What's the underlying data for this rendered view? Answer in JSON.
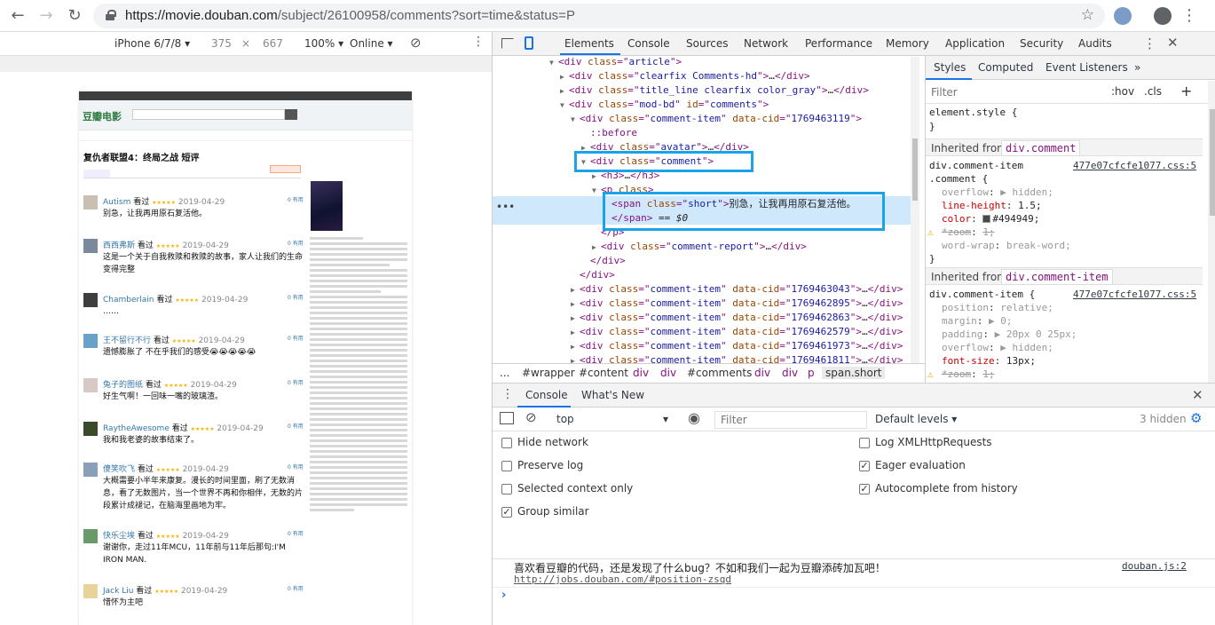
{
  "browser": {
    "url_host": "https://movie.douban.com",
    "url_path": "/subject/26100958/comments?sort=time&status=P"
  },
  "device_toolbar": {
    "device": "iPhone 6/7/8",
    "width": "375",
    "times": "×",
    "height": "667",
    "zoom": "100%",
    "network": "Online"
  },
  "devtools": {
    "tabs": [
      "Elements",
      "Console",
      "Sources",
      "Network",
      "Performance",
      "Memory",
      "Application",
      "Security",
      "Audits"
    ],
    "active_tab": "Elements"
  },
  "elements_tree": {
    "lines": [
      {
        "indent": 0,
        "arrow": "▼",
        "html": "<div class=\"article\">"
      },
      {
        "indent": 1,
        "arrow": "▶",
        "html": "<div class=\"clearfix Comments-hd\">…</div>"
      },
      {
        "indent": 1,
        "arrow": "▶",
        "html": "<div class=\"title_line clearfix color_gray\">…</div>"
      },
      {
        "indent": 1,
        "arrow": "▼",
        "html": "<div class=\"mod-bd\" id=\"comments\">"
      },
      {
        "indent": 2,
        "arrow": "▼",
        "html": "<div class=\"comment-item\" data-cid=\"1769463119\">"
      },
      {
        "indent": 3,
        "arrow": "",
        "html": "::before"
      },
      {
        "indent": 3,
        "arrow": "▶",
        "html": "<div class=\"avatar\">…</div>"
      },
      {
        "indent": 3,
        "arrow": "▼",
        "html": "<div class=\"comment\">"
      },
      {
        "indent": 4,
        "arrow": "▶",
        "html": "<h3>…</h3>"
      },
      {
        "indent": 4,
        "arrow": "▼",
        "html": "<p class>"
      },
      {
        "indent": 5,
        "arrow": "",
        "html": "<span class=\"short\">别急，让我再用原石复活他。"
      },
      {
        "indent": 5,
        "arrow": "",
        "html": "</span> == $0"
      },
      {
        "indent": 4,
        "arrow": "",
        "html": "</p>"
      },
      {
        "indent": 4,
        "arrow": "▶",
        "html": "<div class=\"comment-report\">…</div>"
      },
      {
        "indent": 3,
        "arrow": "",
        "html": "</div>"
      },
      {
        "indent": 2,
        "arrow": "",
        "html": "</div>"
      },
      {
        "indent": 2,
        "arrow": "▶",
        "html": "<div class=\"comment-item\" data-cid=\"1769463043\">…</div>"
      },
      {
        "indent": 2,
        "arrow": "▶",
        "html": "<div class=\"comment-item\" data-cid=\"1769462895\">…</div>"
      },
      {
        "indent": 2,
        "arrow": "▶",
        "html": "<div class=\"comment-item\" data-cid=\"1769462863\">…</div>"
      },
      {
        "indent": 2,
        "arrow": "▶",
        "html": "<div class=\"comment-item\" data-cid=\"1769462579\">…</div>"
      },
      {
        "indent": 2,
        "arrow": "▶",
        "html": "<div class=\"comment-item\" data-cid=\"1769461973\">…</div>"
      },
      {
        "indent": 2,
        "arrow": "▶",
        "html": "<div class=\"comment-item\" data-cid=\"1769461811\">…</div>"
      }
    ]
  },
  "breadcrumbs": [
    "...",
    "#wrapper",
    "#content",
    "div",
    "div",
    "#comments",
    "div",
    "div",
    "p",
    "span.short"
  ],
  "styles_pane": {
    "tabs": [
      "Styles",
      "Computed",
      "Event Listeners",
      "»"
    ],
    "filter_placeholder": "Filter",
    "hov": ":hov",
    "cls": ".cls",
    "plus": "+",
    "element_style": "element.style {",
    "close_brace": "}",
    "inherited_from": "Inherited from",
    "inherited_node_1": "div.comment",
    "inherited_node_2": "div.comment-item",
    "rule1": {
      "selector_1": "div.comment-item",
      "selector_2": ".comment {",
      "source": "477e07cfcfe1077.css:5",
      "props": [
        {
          "name": "overflow",
          "value": "▶ hidden;",
          "state": "disabled"
        },
        {
          "name": "line-height",
          "value": "1.5;",
          "state": "active"
        },
        {
          "name": "color",
          "value": "#494949;",
          "state": "active"
        },
        {
          "name": "*zoom",
          "value": "1;",
          "state": "struck"
        },
        {
          "name": "word-wrap",
          "value": "break-word;",
          "state": "disabled"
        }
      ]
    },
    "rule2": {
      "selector": "div.comment-item {",
      "source": "477e07cfcfe1077.css:5",
      "props": [
        {
          "name": "position",
          "value": "relative;",
          "state": "disabled"
        },
        {
          "name": "margin",
          "value": "▶ 0;",
          "state": "disabled"
        },
        {
          "name": "padding",
          "value": "▶ 20px 0 25px;",
          "state": "disabled"
        },
        {
          "name": "overflow",
          "value": "▶ hidden;",
          "state": "disabled"
        },
        {
          "name": "font-size",
          "value": "13px;",
          "state": "active"
        },
        {
          "name": "*zoom",
          "value": "1;",
          "state": "struck"
        }
      ]
    }
  },
  "console": {
    "tabs": [
      "Console",
      "What's New"
    ],
    "context": "top",
    "filter_placeholder": "Filter",
    "levels": "Default levels",
    "hidden": "3 hidden",
    "options_left": [
      {
        "label": "Hide network",
        "checked": false
      },
      {
        "label": "Preserve log",
        "checked": false
      },
      {
        "label": "Selected context only",
        "checked": false
      },
      {
        "label": "Group similar",
        "checked": true
      }
    ],
    "options_right": [
      {
        "label": "Log XMLHttpRequests",
        "checked": false
      },
      {
        "label": "Eager evaluation",
        "checked": true
      },
      {
        "label": "Autocomplete from history",
        "checked": true
      }
    ],
    "message": "喜欢看豆瓣的代码，还是发现了什么bug？不如和我们一起为豆瓣添砖加瓦吧！",
    "message_link": "http://jobs.douban.com/#position-zsqd",
    "message_source": "douban.js:2",
    "prompt": "›"
  },
  "phone_page": {
    "logo": "豆瓣电影",
    "title": "复仇者联盟4：终局之战 短评",
    "comments": [
      {
        "user": "Autism",
        "kan": "看过",
        "stars": "★★★★★",
        "date": "2019-04-29",
        "text": "别急，让我再用原石复活他。"
      },
      {
        "user": "西西弗斯",
        "kan": "看过",
        "stars": "★★★★★",
        "date": "2019-04-29",
        "text": "这是一个关于自我救赎和救赎的故事，家人让我们的生命变得完整"
      },
      {
        "user": "Chamberlain",
        "kan": "看过",
        "stars": "★★★★★",
        "date": "2019-04-29",
        "text": "……"
      },
      {
        "user": "王不留行不行",
        "kan": "看过",
        "stars": "★★★★★",
        "date": "2019-04-29",
        "text": "遗憾膨胀了 不在乎我们的感受😭😭😭😭😭"
      },
      {
        "user": "兔子的图纸",
        "kan": "看过",
        "stars": "★★★★★",
        "date": "2019-04-29",
        "text": "好生气啊！一回味一嘴的玻璃渣。"
      },
      {
        "user": "RaytheAwesome",
        "kan": "看过",
        "stars": "★★★★★",
        "date": "2019-04-29",
        "text": "我和我老婆的故事结束了。"
      },
      {
        "user": "傻笑吹飞",
        "kan": "看过",
        "stars": "★★★★★",
        "date": "2019-04-29",
        "text": "大概需要小半年来康复。漫长的时间里面，刷了无数消息，看了无数图片，当一个世界不再和你相伴，无数的片段累计成褪记，在脑海里画地为牢。"
      },
      {
        "user": "快乐尘埃",
        "kan": "看过",
        "stars": "★★★★★",
        "date": "2019-04-29",
        "text": "谢谢你，走过11年MCU，11年前与11年后那句:I'M IRON MAN."
      },
      {
        "user": "Jack Liu",
        "kan": "看过",
        "stars": "★★★★★",
        "date": "2019-04-29",
        "text": "惜怀为主吧"
      }
    ]
  }
}
